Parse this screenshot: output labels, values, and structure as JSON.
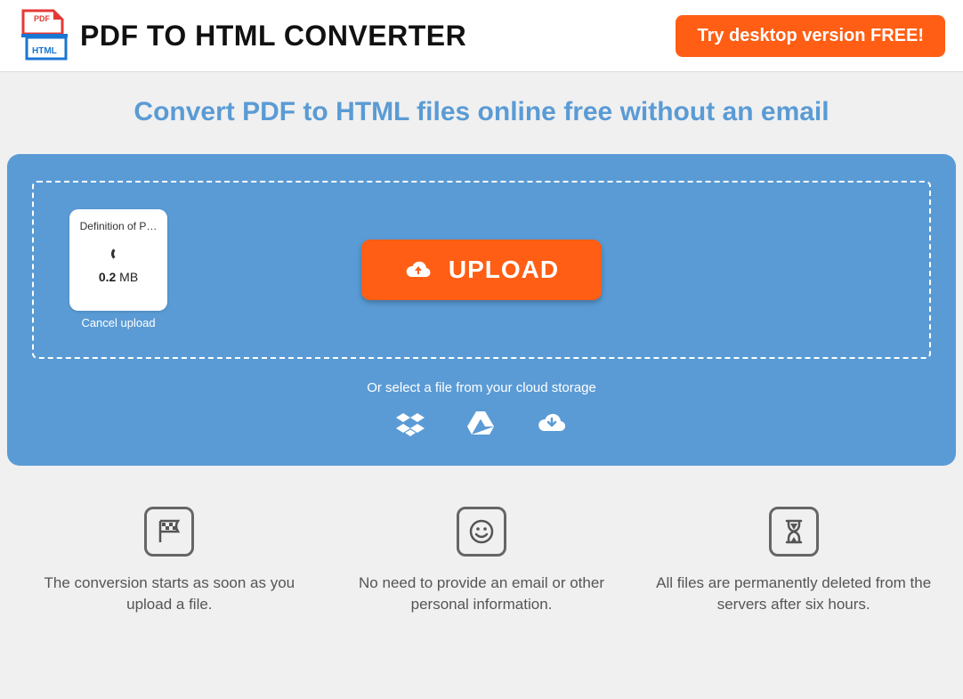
{
  "header": {
    "title": "PDF TO HTML CONVERTER",
    "try_button": "Try desktop version FREE!"
  },
  "subtitle": "Convert PDF to HTML files online free without an email",
  "upload": {
    "button_label": "UPLOAD",
    "file": {
      "name": "Definition of P…",
      "size_value": "0.2",
      "size_unit": " MB"
    },
    "cancel_label": "Cancel upload",
    "cloud_text": "Or select a file from your cloud storage"
  },
  "features": [
    {
      "text": "The conversion starts as soon as you upload a file."
    },
    {
      "text": "No need to provide an email or other personal information."
    },
    {
      "text": "All files are permanently deleted from the servers after six hours."
    }
  ]
}
